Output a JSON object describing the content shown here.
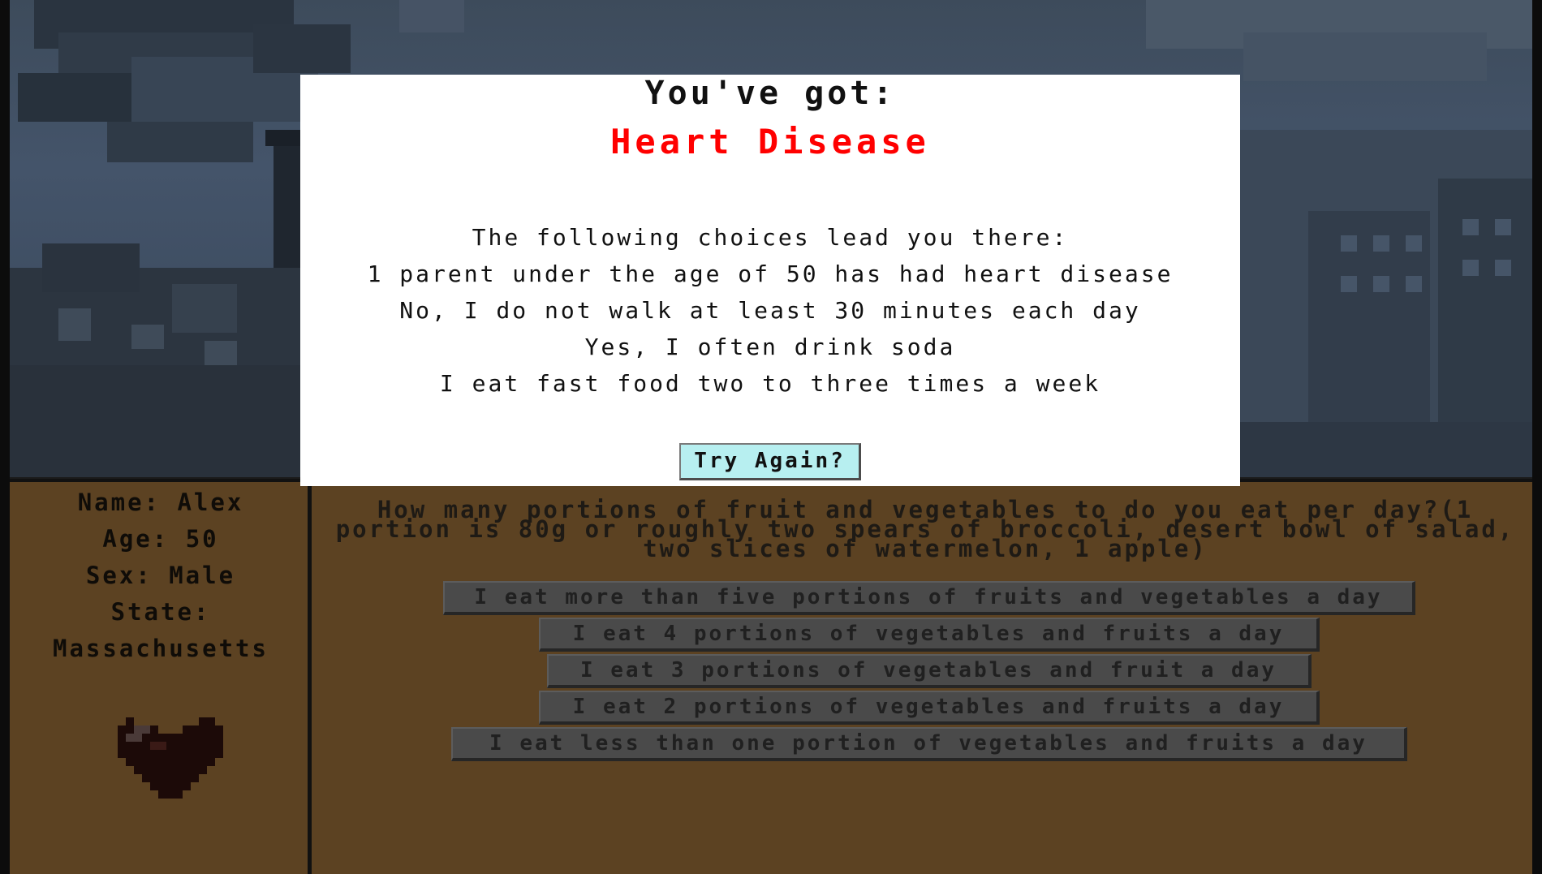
{
  "modal": {
    "heading": "You've got:",
    "disease": "Heart Disease",
    "choices_intro": "The following choices lead you there:",
    "choices": [
      "1 parent under the age of 50 has had heart disease",
      "No, I do not walk at least 30 minutes each day",
      "Yes, I often drink soda",
      "I eat fast food two to three times a week"
    ],
    "try_again_label": "Try Again?"
  },
  "character": {
    "name_line": "Name: Alex",
    "age_line": "Age: 50",
    "sex_line": "Sex: Male",
    "state_label": "State:",
    "state_value": "Massachusetts",
    "health_icon": "heart-icon"
  },
  "question": {
    "text": "How many portions of fruit and vegetables to do you eat per day?(1 portion is 80g or roughly two spears of broccoli, desert bowl of salad, two slices of watermelon, 1 apple)",
    "answers": [
      "I eat more than five portions of fruits and vegetables a day",
      "I eat 4 portions of vegetables and fruits a day",
      "I eat 3 portions of vegetables and fruit a day",
      "I eat 2 portions of vegetables and fruits a day",
      "I eat less than one portion of vegetables and fruits a day"
    ]
  },
  "colors": {
    "disease": "#ff0000",
    "panel": "#5c4222",
    "button": "#b7eff0",
    "modal": "#ffffff"
  }
}
